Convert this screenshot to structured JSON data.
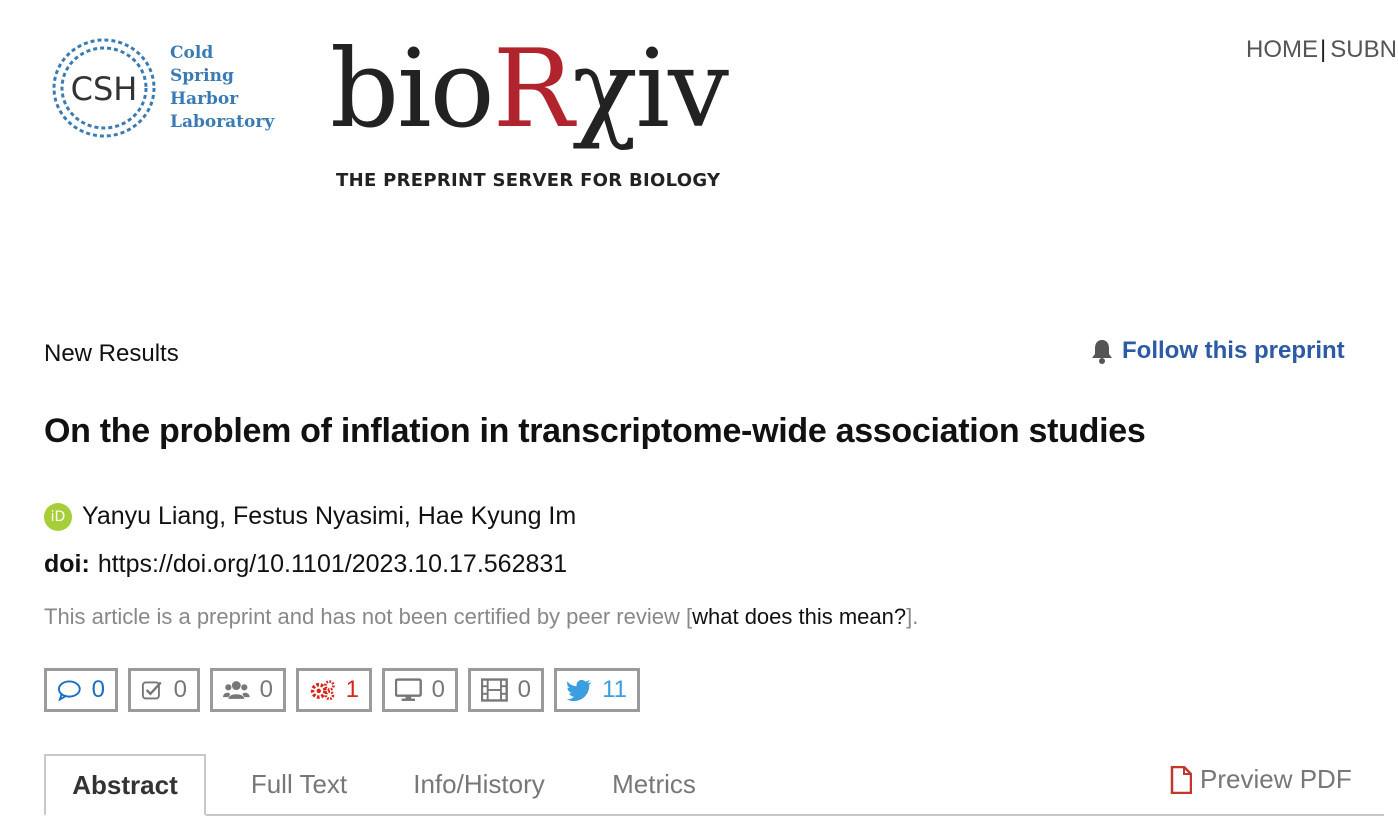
{
  "header": {
    "csh_logo_lines": [
      "Cold",
      "Spring",
      "Harbor",
      "Laboratory"
    ],
    "csh_monogram": "CSH",
    "brand_prefix": "bio",
    "brand_accent": "R",
    "brand_suffix": "χiv",
    "tagline": "THE PREPRINT SERVER FOR BIOLOGY",
    "nav": {
      "home": "HOME",
      "separator": "|",
      "submit": "SUBN"
    }
  },
  "article": {
    "section": "New Results",
    "follow_label": "Follow this preprint",
    "title": "On the problem of inflation in transcriptome-wide association studies",
    "orcid_glyph": "iD",
    "authors": "Yanyu Liang, Festus Nyasimi, Hae Kyung Im",
    "doi_label": "doi:",
    "doi_value": "https://doi.org/10.1101/2023.10.17.562831",
    "disclaimer_before": "This article is a preprint and has not been certified by peer review [",
    "disclaimer_link": "what does this mean?",
    "disclaimer_after": "]."
  },
  "metrics": [
    {
      "icon": "comment-icon",
      "value": "0",
      "color": "#1a6fc4"
    },
    {
      "icon": "check-square-icon",
      "value": "0",
      "color": "#777777"
    },
    {
      "icon": "users-icon",
      "value": "0",
      "color": "#777777"
    },
    {
      "icon": "cogs-icon",
      "value": "1",
      "color": "#d9261c"
    },
    {
      "icon": "monitor-icon",
      "value": "0",
      "color": "#777777"
    },
    {
      "icon": "film-icon",
      "value": "0",
      "color": "#777777"
    },
    {
      "icon": "twitter-icon",
      "value": "11",
      "color": "#3a9ee0"
    }
  ],
  "tabs": {
    "abstract": "Abstract",
    "full_text": "Full Text",
    "info_history": "Info/History",
    "metrics": "Metrics",
    "preview_pdf": "Preview PDF"
  },
  "colors": {
    "brand_red": "#b2242d",
    "link_blue": "#2c5aa5",
    "orcid_green": "#a6ce39",
    "csh_blue": "#3b7bb3"
  }
}
